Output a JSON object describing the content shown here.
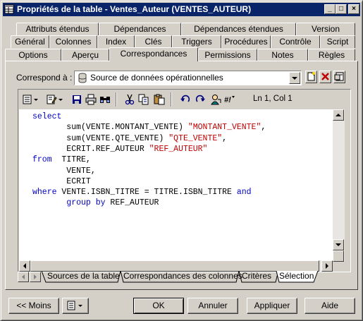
{
  "window": {
    "title": "Propriétés de la table - Ventes_Auteur (VENTES_AUTEUR)"
  },
  "tabs": {
    "row1": [
      "Attributs étendus",
      "Dépendances",
      "Dépendances étendues",
      "Version"
    ],
    "row2": [
      "Général",
      "Colonnes",
      "Index",
      "Clés",
      "Triggers",
      "Procédures",
      "Contrôle",
      "Script"
    ],
    "row3": [
      "Options",
      "Aperçu",
      "Correspondances",
      "Permissions",
      "Notes",
      "Règles"
    ],
    "active": "Correspondances"
  },
  "mapping": {
    "label": "Correspond à :",
    "selected": "Source de données opérationnelles"
  },
  "editor": {
    "cursor": "Ln 1, Col 1",
    "lines": [
      {
        "k": "select"
      },
      {
        "t": "       sum(VENTE.MONTANT_VENTE) ",
        "s": "\"MONTANT_VENTE\"",
        "e": ","
      },
      {
        "t": "       sum(VENTE.QTE_VENTE) ",
        "s": "\"QTE_VENTE\"",
        "e": ","
      },
      {
        "t": "       ECRIT.REF_AUTEUR ",
        "s": "\"REF_AUTEUR\""
      },
      {
        "k": "from",
        "t": "  TITRE,"
      },
      {
        "t": "       VENTE,"
      },
      {
        "t": "       ECRIT"
      },
      {
        "k": "where",
        "t": " VENTE.ISBN_TITRE = TITRE.ISBN_TITRE ",
        "k2": "and"
      },
      {
        "t": "       ",
        "k": "group by",
        "t2": " REF_AUTEUR"
      }
    ]
  },
  "bottom_tabs": [
    "Sources de la table",
    "Correspondances des colonnes",
    "Critères",
    "Sélection"
  ],
  "bottom_tab_active": "Sélection",
  "buttons": {
    "less": "<< Moins",
    "ok": "OK",
    "cancel": "Annuler",
    "apply": "Appliquer",
    "help": "Aide"
  },
  "icons": [
    "table-icon",
    "minimize-icon",
    "maximize-icon",
    "close-icon",
    "database-icon",
    "dropdown-arrow-icon",
    "new-icon",
    "delete-icon",
    "properties-icon",
    "menu-icon",
    "edit-icon",
    "save-icon",
    "print-icon",
    "find-icon",
    "cut-icon",
    "copy-icon",
    "paste-icon",
    "undo-icon",
    "redo-icon",
    "variables-icon",
    "sql-icon"
  ]
}
